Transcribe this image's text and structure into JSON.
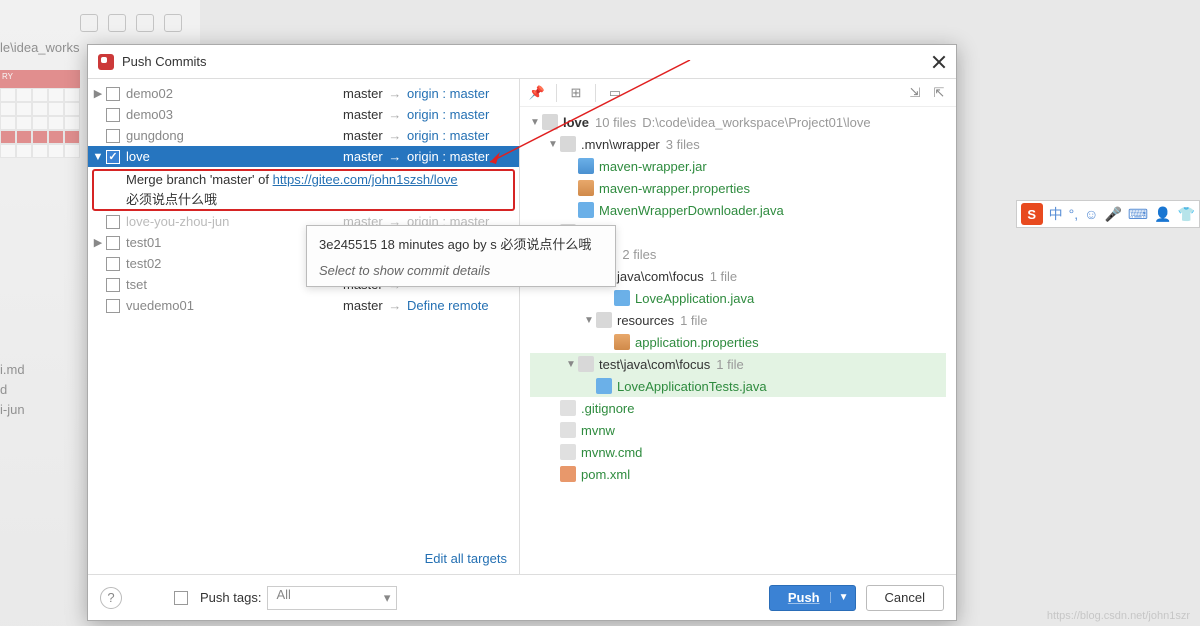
{
  "bg_path": "le\\idea_works",
  "bg_calendar_head": "RY",
  "bg_files": [
    "i.md",
    "d",
    "i-jun"
  ],
  "dialog": {
    "title": "Push Commits",
    "repos": [
      {
        "name": "demo02",
        "local": "master",
        "remote": "origin : master",
        "checked": false,
        "exp": "▶"
      },
      {
        "name": "demo03",
        "local": "master",
        "remote": "origin : master",
        "checked": false,
        "exp": ""
      },
      {
        "name": "gungdong",
        "local": "master",
        "remote": "origin : master",
        "checked": false,
        "exp": ""
      },
      {
        "name": "love",
        "local": "master",
        "remote": "origin : master",
        "checked": true,
        "exp": "▼",
        "selected": true
      },
      {
        "name": "love-you-zhou-jun",
        "local": "master",
        "remote": "origin : master",
        "checked": false,
        "exp": "",
        "gray": true
      },
      {
        "name": "test01",
        "local": "master",
        "remote": "",
        "checked": false,
        "exp": "▶"
      },
      {
        "name": "test02",
        "local": "master",
        "remote": "",
        "checked": false,
        "exp": ""
      },
      {
        "name": "tset",
        "local": "master",
        "remote": "",
        "checked": false,
        "exp": ""
      },
      {
        "name": "vuedemo01",
        "local": "master",
        "remote": "Define remote",
        "checked": false,
        "exp": "",
        "remote_link": true
      }
    ],
    "commit": {
      "prefix": "Merge branch 'master' of ",
      "link": "https://gitee.com/john1szsh/love",
      "cn": "必须说点什么哦"
    },
    "edit_targets": "Edit all targets"
  },
  "tooltip": {
    "line1": "3e245515 18 minutes ago by s 必须说点什么哦",
    "line2": "Select to show commit details"
  },
  "right": {
    "root": "love",
    "root_count": "10 files",
    "root_path": "D:\\code\\idea_workspace\\Project01\\love",
    "items": [
      {
        "indent": 1,
        "exp": "▼",
        "type": "folder",
        "name": ".mvn\\wrapper",
        "suffix": "3 files"
      },
      {
        "indent": 2,
        "exp": "",
        "type": "jar",
        "name": "maven-wrapper.jar",
        "green": true
      },
      {
        "indent": 2,
        "exp": "",
        "type": "prop",
        "name": "maven-wrapper.properties",
        "green": true
      },
      {
        "indent": 2,
        "exp": "",
        "type": "java",
        "name": "MavenWrapperDownloader.java",
        "green": true
      },
      {
        "indent": 1,
        "exp": "▼",
        "type": "folder",
        "name": "",
        "suffix": "files",
        "cut": true
      },
      {
        "indent": 2,
        "exp": "▼",
        "type": "folder",
        "name": "ain",
        "suffix": "2 files",
        "cut": true
      },
      {
        "indent": 3,
        "exp": "▼",
        "type": "folder",
        "name": "java\\com\\focus",
        "suffix": "1 file"
      },
      {
        "indent": 4,
        "exp": "",
        "type": "java",
        "name": "LoveApplication.java",
        "green": true
      },
      {
        "indent": 3,
        "exp": "▼",
        "type": "folder",
        "name": "resources",
        "suffix": "1 file"
      },
      {
        "indent": 4,
        "exp": "",
        "type": "prop",
        "name": "application.properties",
        "green": true
      },
      {
        "indent": 2,
        "exp": "▼",
        "type": "folder",
        "name": "test\\java\\com\\focus",
        "suffix": "1 file",
        "hl": true
      },
      {
        "indent": 3,
        "exp": "",
        "type": "java",
        "name": "LoveApplicationTests.java",
        "green": true,
        "hl": true
      },
      {
        "indent": 1,
        "exp": "",
        "type": "file",
        "name": ".gitignore",
        "green": true
      },
      {
        "indent": 1,
        "exp": "",
        "type": "file",
        "name": "mvnw",
        "green": true
      },
      {
        "indent": 1,
        "exp": "",
        "type": "file",
        "name": "mvnw.cmd",
        "green": true
      },
      {
        "indent": 1,
        "exp": "",
        "type": "xml",
        "name": "pom.xml",
        "green": true
      }
    ]
  },
  "footer": {
    "push_tags": "Push tags:",
    "tags_value": "All",
    "push": "Push",
    "cancel": "Cancel"
  },
  "sogou": {
    "chars": [
      "中",
      "°,",
      "☺",
      "🎤",
      "⌨",
      "👤",
      "👕"
    ]
  },
  "watermark": "https://blog.csdn.net/john1szr"
}
